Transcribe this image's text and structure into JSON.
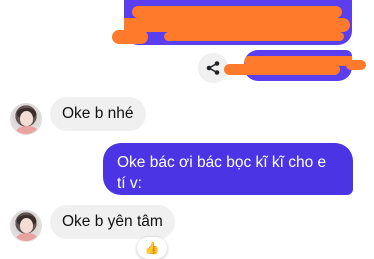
{
  "messages": [
    {
      "direction": "outgoing",
      "redacted": true
    },
    {
      "direction": "outgoing",
      "redacted": true
    },
    {
      "direction": "incoming",
      "text": "Oke b nhé"
    },
    {
      "direction": "outgoing",
      "text": "Oke bác ơi bác bọc kĩ kĩ cho e tí v:"
    },
    {
      "direction": "incoming",
      "text": "Oke b yên tâm",
      "reaction": "👍"
    }
  ],
  "icons": {
    "share": "share-icon",
    "reaction": "thumbs-up-icon"
  },
  "colors": {
    "outgoing_bubble": "#4a34e4",
    "incoming_bubble": "#f0f0f0",
    "redaction_scribble": "#ff7a2a"
  }
}
